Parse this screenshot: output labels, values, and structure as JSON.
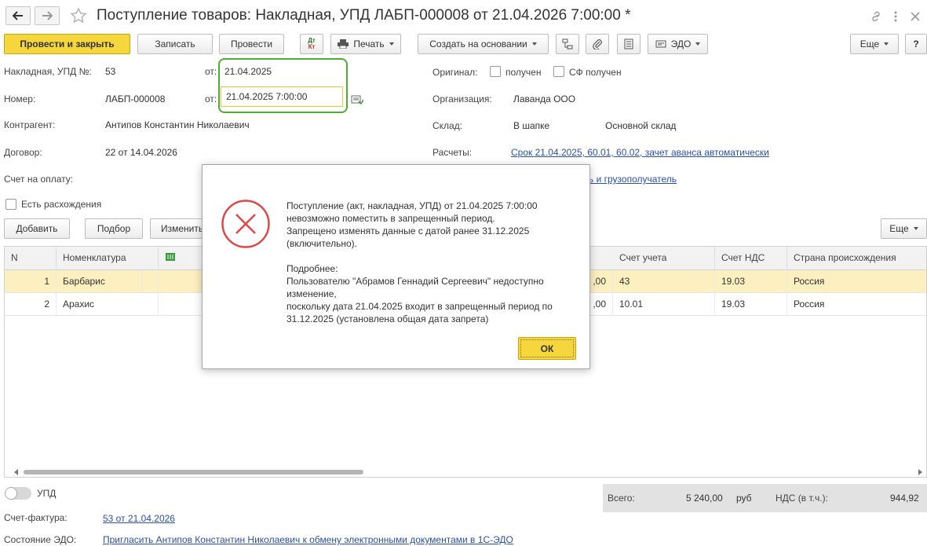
{
  "window": {
    "title": "Поступление товаров: Накладная, УПД ЛАБП-000008 от 21.04.2026 7:00:00 *"
  },
  "toolbar": {
    "post_close": "Провести и закрыть",
    "save": "Записать",
    "post": "Провести",
    "dtkt_top": "Дт",
    "dtkt_bottom": "Кт",
    "print": "Печать",
    "create_based": "Создать на основании",
    "edo": "ЭДО",
    "more": "Еще",
    "help": "?"
  },
  "header": {
    "invoice_label": "Накладная, УПД №:",
    "invoice_value": "53",
    "from_label": "от:",
    "invoice_date": "21.04.2025",
    "number_label": "Номер:",
    "number_value": "ЛАБП-000008",
    "number_date": "21.04.2025  7:00:00",
    "counterparty_label": "Контрагент:",
    "counterparty_value": "Антипов Константин Николаевич",
    "contract_label": "Договор:",
    "contract_value": "22 от 14.04.2026",
    "payment_invoice_label": "Счет на оплату:",
    "discrepancy_label": "Есть расхождения",
    "original_label": "Оригинал:",
    "received_label": "получен",
    "sf_received_label": "СФ получен",
    "org_label": "Организация:",
    "org_value": "Лаванда ООО",
    "warehouse_label": "Склад:",
    "warehouse_mode": "В шапке",
    "warehouse_value": "Основной склад",
    "settlements_label": "Расчеты:",
    "settlements_link": "Срок 21.04.2025, 60.01, 60.02, зачет аванса автоматически",
    "shipper_link_tail": "ь и грузополучатель"
  },
  "table_toolbar": {
    "add": "Добавить",
    "select": "Подбор",
    "change": "Изменить",
    "more": "Еще"
  },
  "table": {
    "columns": [
      "N",
      "Номенклатура",
      "Счет учета",
      "Счет НДС",
      "Страна происхождения"
    ],
    "rows": [
      {
        "n": "1",
        "name": "Барбарис",
        "amount_tail": ",00",
        "account": "43",
        "vat_account": "19.03",
        "country": "Россия"
      },
      {
        "n": "2",
        "name": "Арахис",
        "amount_tail": ",00",
        "account": "10.01",
        "vat_account": "19.03",
        "country": "Россия"
      }
    ]
  },
  "footer": {
    "upd_label": "УПД",
    "invoice_label": "Счет-фактура:",
    "invoice_link": "53 от 21.04.2026",
    "edo_label": "Состояние ЭДО:",
    "edo_link": "Пригласить Антипов Константин Николаевич к обмену электронными документами в 1С-ЭДО",
    "total_label": "Всего:",
    "total_value": "5 240,00",
    "currency": "руб",
    "vat_label": "НДС (в т.ч.):",
    "vat_value": "944,92"
  },
  "dialog": {
    "line1": "Поступление (акт, накладная, УПД)  от 21.04.2025 7:00:00",
    "line2": "невозможно поместить в запрещенный период.",
    "line3": "Запрещено изменять данные с датой ранее 31.12.2025",
    "line4": "(включительно).",
    "line5": "Подробнее:",
    "line6": "Пользователю \"Абрамов Геннадий Сергеевич\" недоступно",
    "line7": "изменение,",
    "line8": "поскольку дата 21.04.2025 входит в запрещенный период по",
    "line9": "31.12.2025 (установлена общая дата запрета)",
    "ok": "ОК"
  },
  "colors": {
    "primary_button": "#f5d63d",
    "link": "#2a4fa8",
    "highlight_outline": "#4caf33",
    "selected_row": "#fcefc0",
    "error_icon": "#e04848"
  }
}
